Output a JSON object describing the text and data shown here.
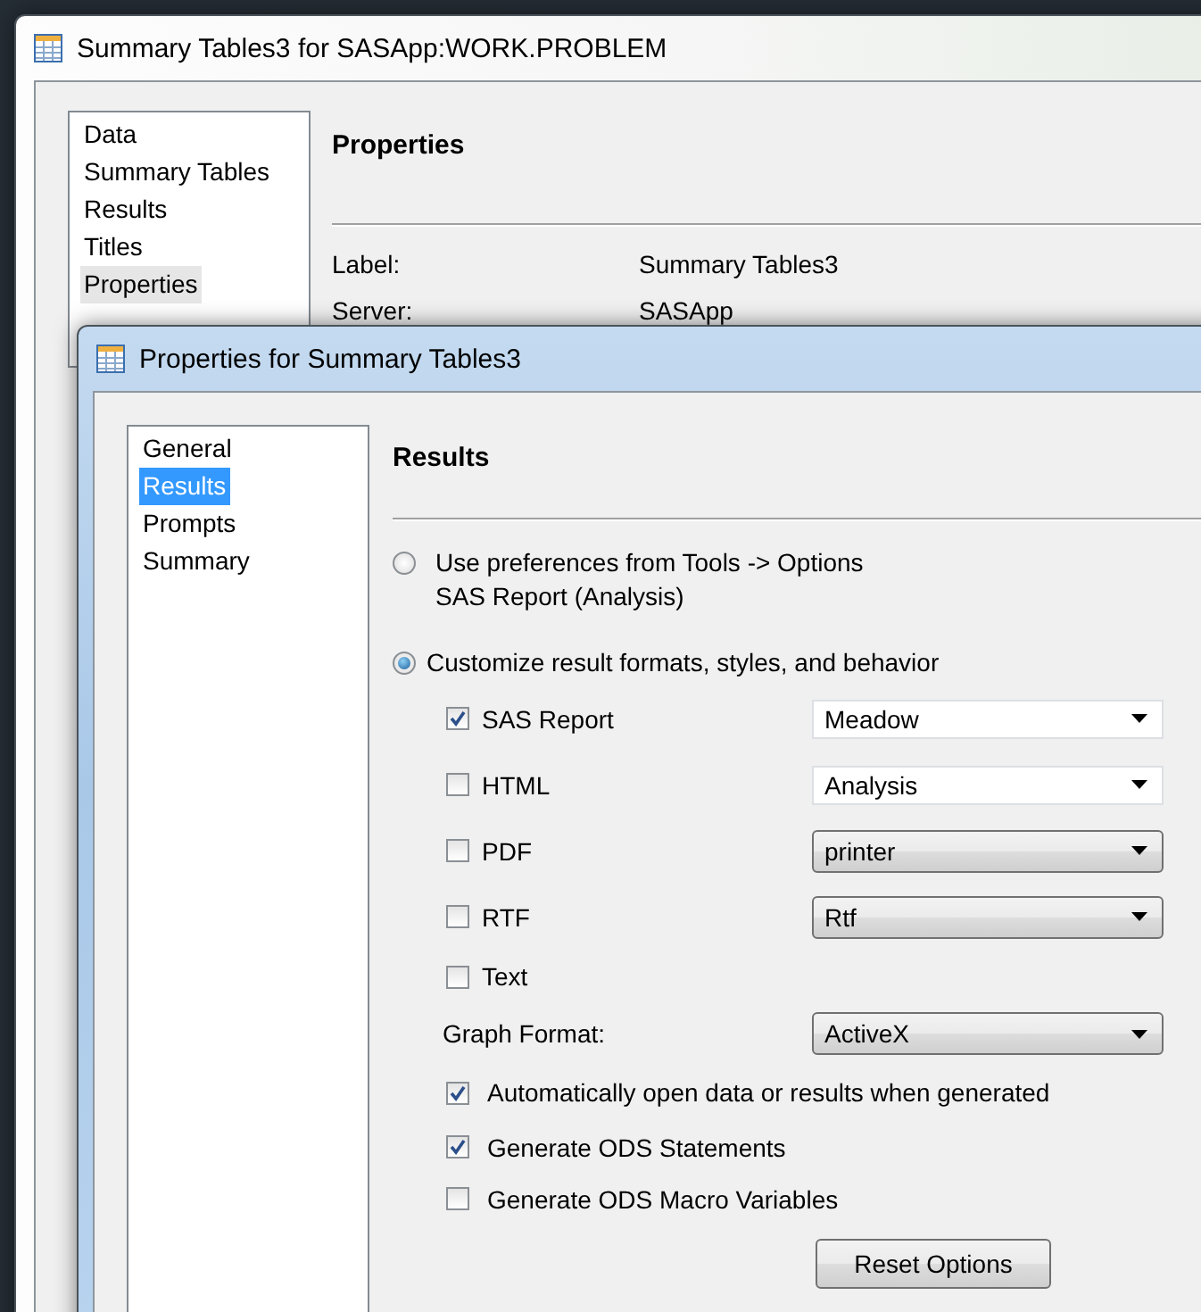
{
  "back_window": {
    "title": "Summary Tables3 for SASApp:WORK.PROBLEM",
    "nav": [
      {
        "label": "Data",
        "selected": false
      },
      {
        "label": "Summary Tables",
        "selected": false
      },
      {
        "label": "Results",
        "selected": false
      },
      {
        "label": "Titles",
        "selected": false
      },
      {
        "label": "Properties",
        "selected": true
      }
    ],
    "heading": "Properties",
    "fields": [
      {
        "label": "Label:",
        "value": "Summary Tables3"
      },
      {
        "label": "Server:",
        "value": "SASApp"
      }
    ]
  },
  "dialog": {
    "title": "Properties for Summary Tables3",
    "nav": [
      {
        "label": "General",
        "selected": false
      },
      {
        "label": "Results",
        "selected": true
      },
      {
        "label": "Prompts",
        "selected": false
      },
      {
        "label": "Summary",
        "selected": false
      }
    ],
    "heading": "Results",
    "options": [
      {
        "label": "Use preferences from Tools -> Options",
        "note": "SAS Report (Analysis)",
        "selected": false
      },
      {
        "label": "Customize result formats, styles, and behavior",
        "selected": true
      }
    ],
    "formats": [
      {
        "label": "SAS Report",
        "checked": true,
        "style": {
          "value": "Meadow",
          "kind": "editable"
        }
      },
      {
        "label": "HTML",
        "checked": false,
        "style": {
          "value": "Analysis",
          "kind": "editable"
        }
      },
      {
        "label": "PDF",
        "checked": false,
        "style": {
          "value": "printer",
          "kind": "list"
        }
      },
      {
        "label": "RTF",
        "checked": false,
        "style": {
          "value": "Rtf",
          "kind": "list"
        }
      },
      {
        "label": "Text",
        "checked": false
      }
    ],
    "graph_format": {
      "label": "Graph Format:",
      "value": "ActiveX"
    },
    "behaviors": [
      {
        "label": "Automatically open data or results when generated",
        "checked": true
      },
      {
        "label": "Generate ODS Statements",
        "checked": true
      },
      {
        "label": "Generate ODS Macro Variables",
        "checked": false
      }
    ],
    "reset_button": "Reset Options"
  }
}
